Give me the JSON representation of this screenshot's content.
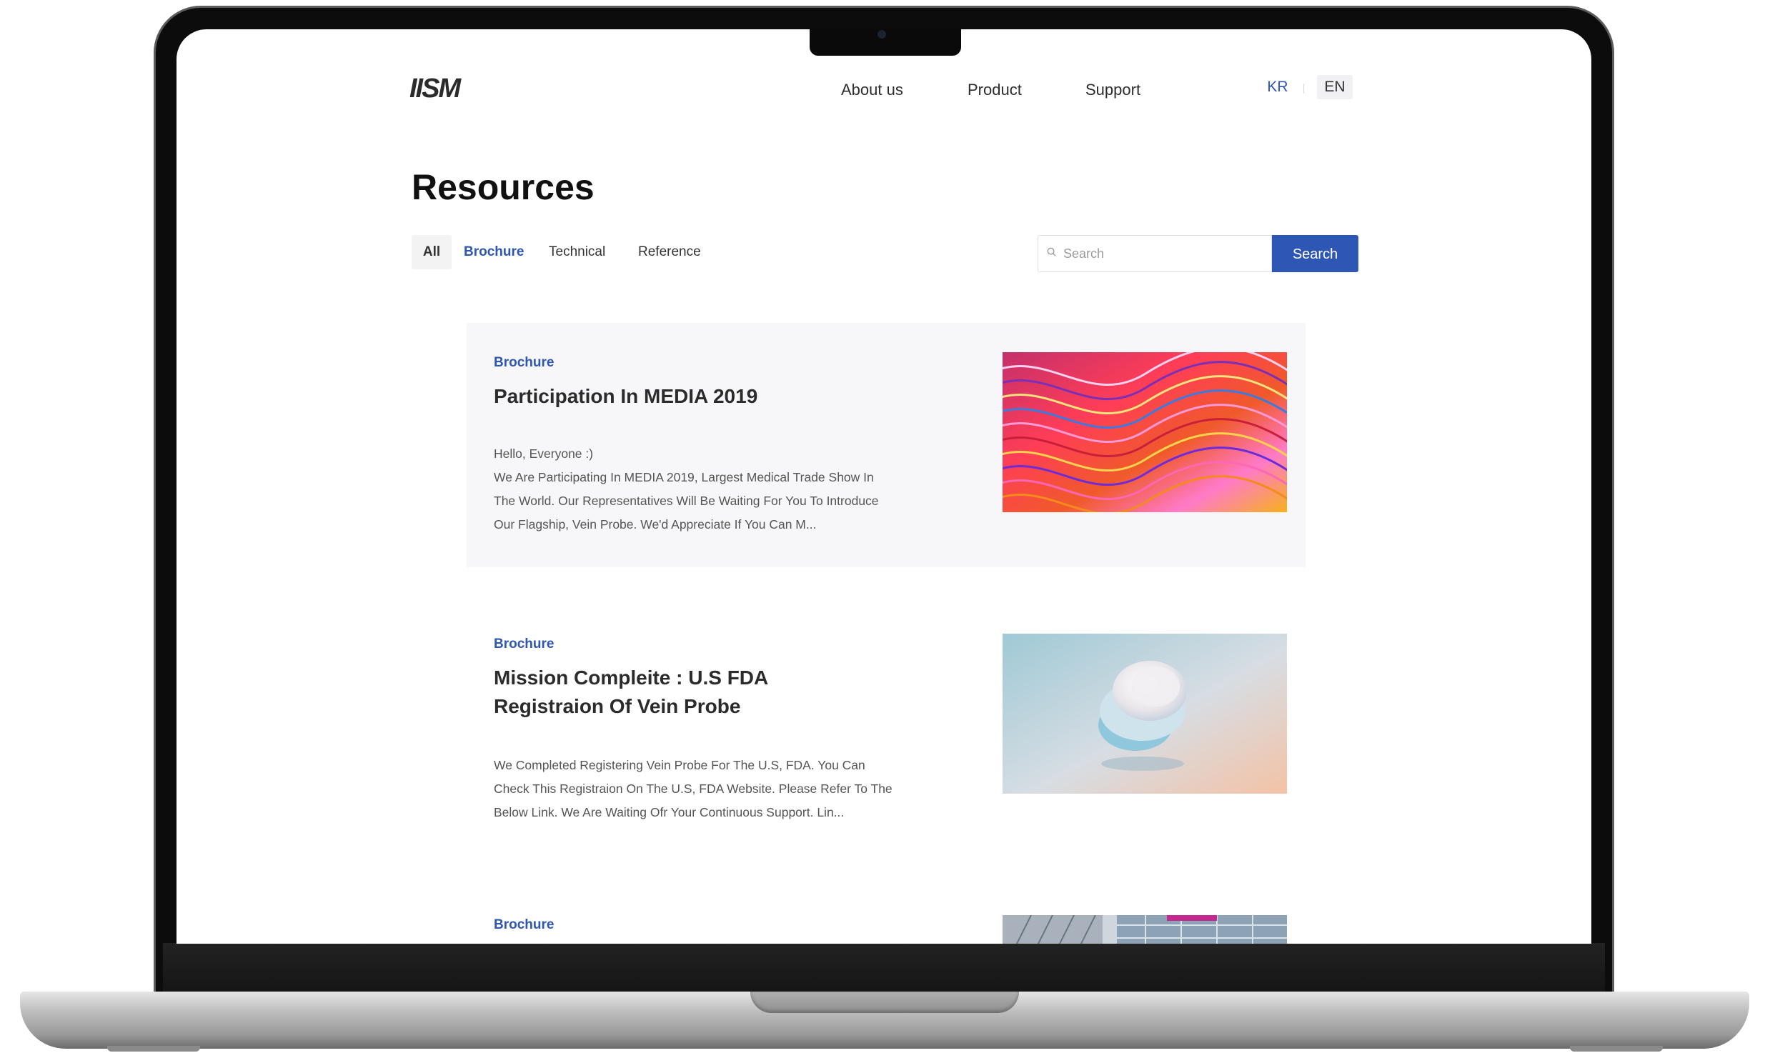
{
  "header": {
    "logo_text": "IISM",
    "nav": [
      "About us",
      "Product",
      "Support"
    ],
    "languages": [
      "KR",
      "EN"
    ],
    "active_language": "KR"
  },
  "page_title": "Resources",
  "filters": {
    "tabs": [
      "All",
      "Brochure",
      "Technical",
      "Reference"
    ],
    "active": "Brochure"
  },
  "search": {
    "placeholder": "Search",
    "value": "",
    "button_label": "Search"
  },
  "posts": [
    {
      "category": "Brochure",
      "title": "Participation In MEDIA 2019",
      "body": [
        "Hello, Everyone :)",
        "We Are Participating In MEDIA 2019, Largest Medical Trade Show In",
        "The World. Our Representatives Will Be Waiting For You To Introduce",
        "Our Flagship, Vein Probe. We'd Appreciate If You Can M..."
      ]
    },
    {
      "category": "Brochure",
      "title": [
        "Mission Compleite : U.S FDA",
        "Registraion Of Vein Probe"
      ],
      "body": [
        "We Completed Registering Vein Probe For The U.S, FDA. You Can",
        "Check This Registraion On The U.S, FDA Website. Please Refer To The",
        "Below Link. We Are Waiting Ofr Your Continuous Support. Lin..."
      ]
    },
    {
      "category": "Brochure"
    }
  ],
  "colors": {
    "accent": "#2e56b4",
    "card_bg": "#f7f7f9",
    "text": "#2b2b2b"
  },
  "icons": [
    "search-icon"
  ]
}
